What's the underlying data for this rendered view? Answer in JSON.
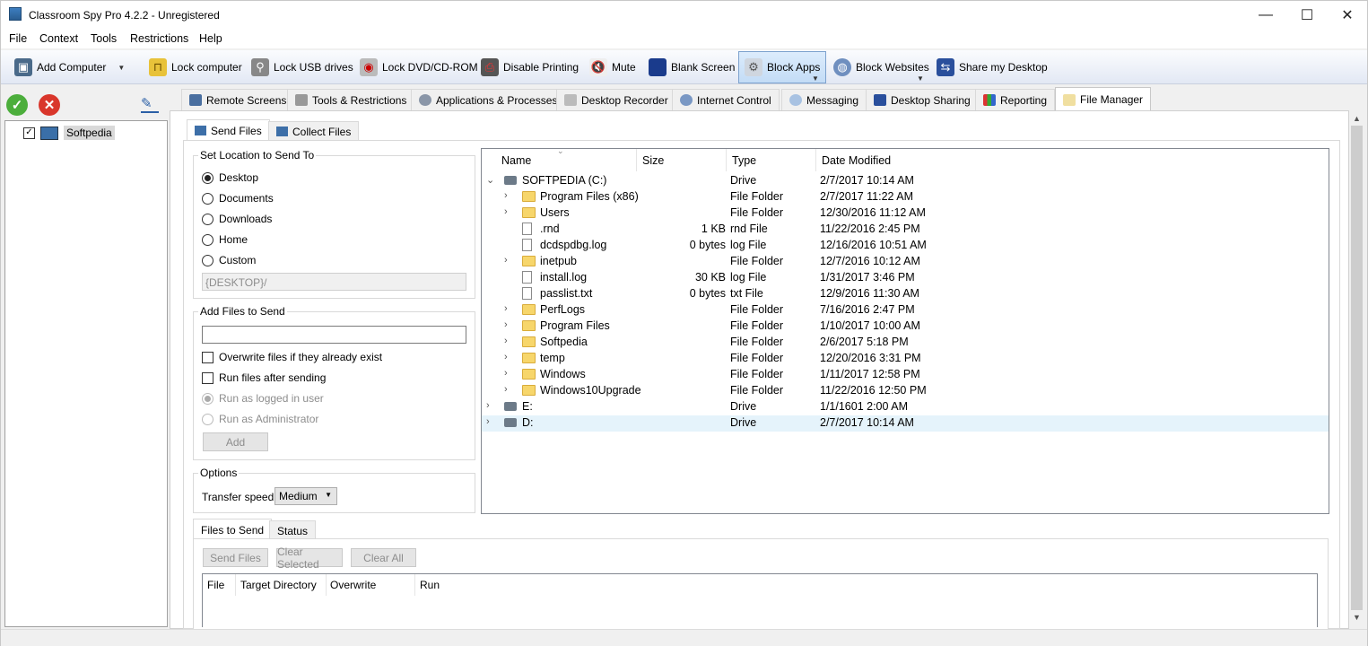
{
  "window": {
    "title": "Classroom Spy Pro 4.2.2 - Unregistered",
    "minimize": "—",
    "maximize": "☐",
    "close": "✕"
  },
  "menu": [
    "File",
    "Context",
    "Tools",
    "Restrictions",
    "Help"
  ],
  "toolbar": {
    "add_computer": "Add Computer",
    "lock_computer": "Lock computer",
    "lock_usb": "Lock USB drives",
    "lock_dvd": "Lock DVD/CD-ROM",
    "disable_printing": "Disable Printing",
    "mute": "Mute",
    "blank_screen": "Blank Screen",
    "block_apps": "Block Apps",
    "block_websites": "Block Websites",
    "share_desktop": "Share my Desktop"
  },
  "computers": [
    {
      "name": "Softpedia",
      "checked": true
    }
  ],
  "main_tabs": [
    "Remote Screens",
    "Tools & Restrictions",
    "Applications & Processes",
    "Desktop Recorder",
    "Internet Control",
    "Messaging",
    "Desktop Sharing",
    "Reporting",
    "File Manager"
  ],
  "active_main_tab": "File Manager",
  "file_tabs": {
    "send": "Send Files",
    "collect": "Collect Files"
  },
  "location": {
    "label": "Set Location to Send To",
    "options": [
      "Desktop",
      "Documents",
      "Downloads",
      "Home",
      "Custom"
    ],
    "selected": "Desktop",
    "path": "{DESKTOP}/"
  },
  "add_files": {
    "label": "Add Files to Send",
    "input_value": "",
    "overwrite": "Overwrite files if they already exist",
    "run_after": "Run files after sending",
    "run_as_user": "Run as logged in user",
    "run_as_admin": "Run as Administrator",
    "add_button": "Add"
  },
  "options": {
    "label": "Options",
    "speed_label": "Transfer speed:",
    "speed_value": "Medium"
  },
  "file_columns": [
    "Name",
    "Size",
    "Type",
    "Date Modified"
  ],
  "files": [
    {
      "name": "SOFTPEDIA (C:)",
      "size": "",
      "type": "Drive",
      "date": "2/7/2017 10:14 AM",
      "icon": "drive-icon",
      "level": 0,
      "chevron": "expanded"
    },
    {
      "name": "Program Files (x86)",
      "size": "",
      "type": "File Folder",
      "date": "2/7/2017 11:22 AM",
      "icon": "folder-icon",
      "level": 1,
      "chevron": "collapsed"
    },
    {
      "name": "Users",
      "size": "",
      "type": "File Folder",
      "date": "12/30/2016 11:12 AM",
      "icon": "folder-icon",
      "level": 1,
      "chevron": "collapsed"
    },
    {
      "name": ".rnd",
      "size": "1 KB",
      "type": "rnd File",
      "date": "11/22/2016 2:45 PM",
      "icon": "file-icon",
      "level": 1,
      "chevron": ""
    },
    {
      "name": "dcdspdbg.log",
      "size": "0 bytes",
      "type": "log File",
      "date": "12/16/2016 10:51 AM",
      "icon": "file-icon",
      "level": 1,
      "chevron": ""
    },
    {
      "name": "inetpub",
      "size": "",
      "type": "File Folder",
      "date": "12/7/2016 10:12 AM",
      "icon": "folder-icon",
      "level": 1,
      "chevron": "collapsed"
    },
    {
      "name": "install.log",
      "size": "30 KB",
      "type": "log File",
      "date": "1/31/2017 3:46 PM",
      "icon": "file-icon",
      "level": 1,
      "chevron": ""
    },
    {
      "name": "passlist.txt",
      "size": "0 bytes",
      "type": "txt File",
      "date": "12/9/2016 11:30 AM",
      "icon": "file-icon",
      "level": 1,
      "chevron": ""
    },
    {
      "name": "PerfLogs",
      "size": "",
      "type": "File Folder",
      "date": "7/16/2016 2:47 PM",
      "icon": "folder-icon",
      "level": 1,
      "chevron": "collapsed"
    },
    {
      "name": "Program Files",
      "size": "",
      "type": "File Folder",
      "date": "1/10/2017 10:00 AM",
      "icon": "folder-icon",
      "level": 1,
      "chevron": "collapsed"
    },
    {
      "name": "Softpedia",
      "size": "",
      "type": "File Folder",
      "date": "2/6/2017 5:18 PM",
      "icon": "folder-icon",
      "level": 1,
      "chevron": "collapsed"
    },
    {
      "name": "temp",
      "size": "",
      "type": "File Folder",
      "date": "12/20/2016 3:31 PM",
      "icon": "folder-icon",
      "level": 1,
      "chevron": "collapsed"
    },
    {
      "name": "Windows",
      "size": "",
      "type": "File Folder",
      "date": "1/11/2017 12:58 PM",
      "icon": "folder-icon",
      "level": 1,
      "chevron": "collapsed"
    },
    {
      "name": "Windows10Upgrade",
      "size": "",
      "type": "File Folder",
      "date": "11/22/2016 12:50 PM",
      "icon": "folder-icon",
      "level": 1,
      "chevron": "collapsed"
    },
    {
      "name": "E:",
      "size": "",
      "type": "Drive",
      "date": "1/1/1601 2:00 AM",
      "icon": "drive-icon",
      "level": 0,
      "chevron": "collapsed"
    },
    {
      "name": "D:",
      "size": "",
      "type": "Drive",
      "date": "2/7/2017 10:14 AM",
      "icon": "drive-icon",
      "level": 0,
      "chevron": "collapsed",
      "selected": true
    }
  ],
  "bottom_tabs": {
    "files_to_send": "Files to Send",
    "status": "Status"
  },
  "queue_buttons": {
    "send": "Send Files",
    "clear_selected": "Clear Selected",
    "clear_all": "Clear All"
  },
  "queue_columns": [
    "File",
    "Target Directory",
    "Overwrite",
    "Run"
  ]
}
